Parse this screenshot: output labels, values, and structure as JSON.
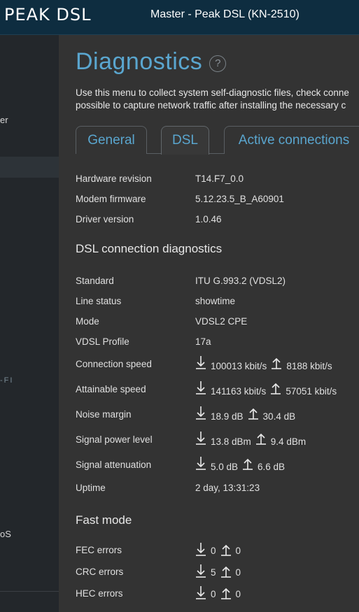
{
  "header": {
    "brand": "PEAK DSL",
    "device": "Master - Peak DSL (KN-2510)"
  },
  "sidebar": {
    "item1": "er",
    "fi_label": "-FI",
    "item2": "oS"
  },
  "page": {
    "title": "Diagnostics",
    "help": "?",
    "desc1": "Use this menu to collect system self-diagnostic files, check conne",
    "desc2": "possible to capture network traffic after installing the necessary c"
  },
  "tabs": [
    {
      "label": "General"
    },
    {
      "label": "DSL"
    },
    {
      "label": "Active connections"
    }
  ],
  "info": [
    {
      "label": "Hardware revision",
      "value": "T14.F7_0.0"
    },
    {
      "label": "Modem firmware",
      "value": "5.12.23.5_B_A60901"
    },
    {
      "label": "Driver version",
      "value": "1.0.46"
    }
  ],
  "sections": {
    "dsl": "DSL connection diagnostics",
    "fast": "Fast mode"
  },
  "dsl": [
    {
      "label": "Standard",
      "value": "ITU G.993.2 (VDSL2)"
    },
    {
      "label": "Line status",
      "value": "showtime"
    },
    {
      "label": "Mode",
      "value": "VDSL2 CPE"
    },
    {
      "label": "VDSL Profile",
      "value": "17a"
    },
    {
      "label": "Connection speed",
      "down": "100013 kbit/s",
      "up": "8188 kbit/s"
    },
    {
      "label": "Attainable speed",
      "down": "141163 kbit/s",
      "up": "57051 kbit/s"
    },
    {
      "label": "Noise margin",
      "down": "18.9 dB",
      "up": "30.4 dB"
    },
    {
      "label": "Signal power level",
      "down": "13.8 dBm",
      "up": "9.4 dBm"
    },
    {
      "label": "Signal attenuation",
      "down": "5.0 dB",
      "up": "6.6 dB"
    },
    {
      "label": "Uptime",
      "value": "2 day, 13:31:23"
    }
  ],
  "fast": [
    {
      "label": "FEC errors",
      "down": "0",
      "up": "0"
    },
    {
      "label": "CRC errors",
      "down": "5",
      "up": "0"
    },
    {
      "label": "HEC errors",
      "down": "0",
      "up": "0"
    }
  ],
  "colors": {
    "accent": "#5aa6cf",
    "header_bg": "#0e2d40",
    "sidebar_bg": "#23272b",
    "main_bg": "#333333"
  }
}
